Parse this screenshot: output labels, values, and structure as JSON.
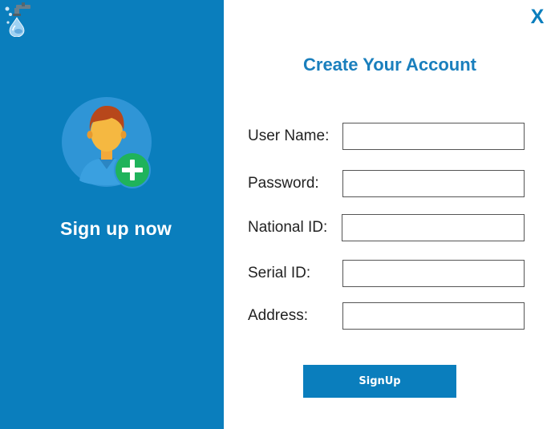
{
  "left_panel": {
    "logo_icon": "faucet-water-drop-icon",
    "avatar_icon": "user-add-icon",
    "caption": "Sign up now"
  },
  "window": {
    "close_label": "X"
  },
  "form": {
    "title": "Create Your Account",
    "fields": [
      {
        "label": "User Name:",
        "value": "",
        "placeholder": ""
      },
      {
        "label": "Password:",
        "value": "",
        "placeholder": ""
      },
      {
        "label": "National ID:",
        "value": "",
        "placeholder": ""
      },
      {
        "label": "Serial ID:",
        "value": "",
        "placeholder": ""
      },
      {
        "label": "Address:",
        "value": "",
        "placeholder": ""
      }
    ],
    "submit_label": "SignUp"
  },
  "colors": {
    "panel_blue": "#0a7ebd",
    "title_blue": "#1a7fbd",
    "avatar_circle": "#2f95d6",
    "add_badge_green": "#1fb35b"
  }
}
